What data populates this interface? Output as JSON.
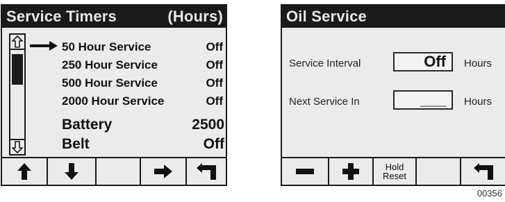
{
  "service_timers": {
    "title": "Service Timers",
    "title_unit": "(Hours)",
    "items": [
      {
        "label": "50 Hour Service",
        "value": "Off"
      },
      {
        "label": "250 Hour Service",
        "value": "Off"
      },
      {
        "label": "500 Hour Service",
        "value": "Off"
      },
      {
        "label": "2000 Hour Service",
        "value": "Off"
      },
      {
        "label": "Battery",
        "value": "2500"
      },
      {
        "label": "Belt",
        "value": "Off"
      }
    ],
    "softkeys": [
      "up-arrow-icon",
      "down-arrow-icon",
      "blank",
      "right-arrow-icon",
      "back-return-icon"
    ]
  },
  "oil_service": {
    "title": "Oil Service",
    "service_interval": {
      "label": "Service Interval",
      "value": "Off",
      "unit": "Hours"
    },
    "next_service": {
      "label": "Next Service In",
      "value": "___",
      "unit": "Hours"
    },
    "softkeys": {
      "minus": "minus-icon",
      "plus": "plus-icon",
      "hold_line1": "Hold",
      "hold_line2": "Reset",
      "back": "back-return-icon"
    }
  },
  "figure_number": "00356"
}
